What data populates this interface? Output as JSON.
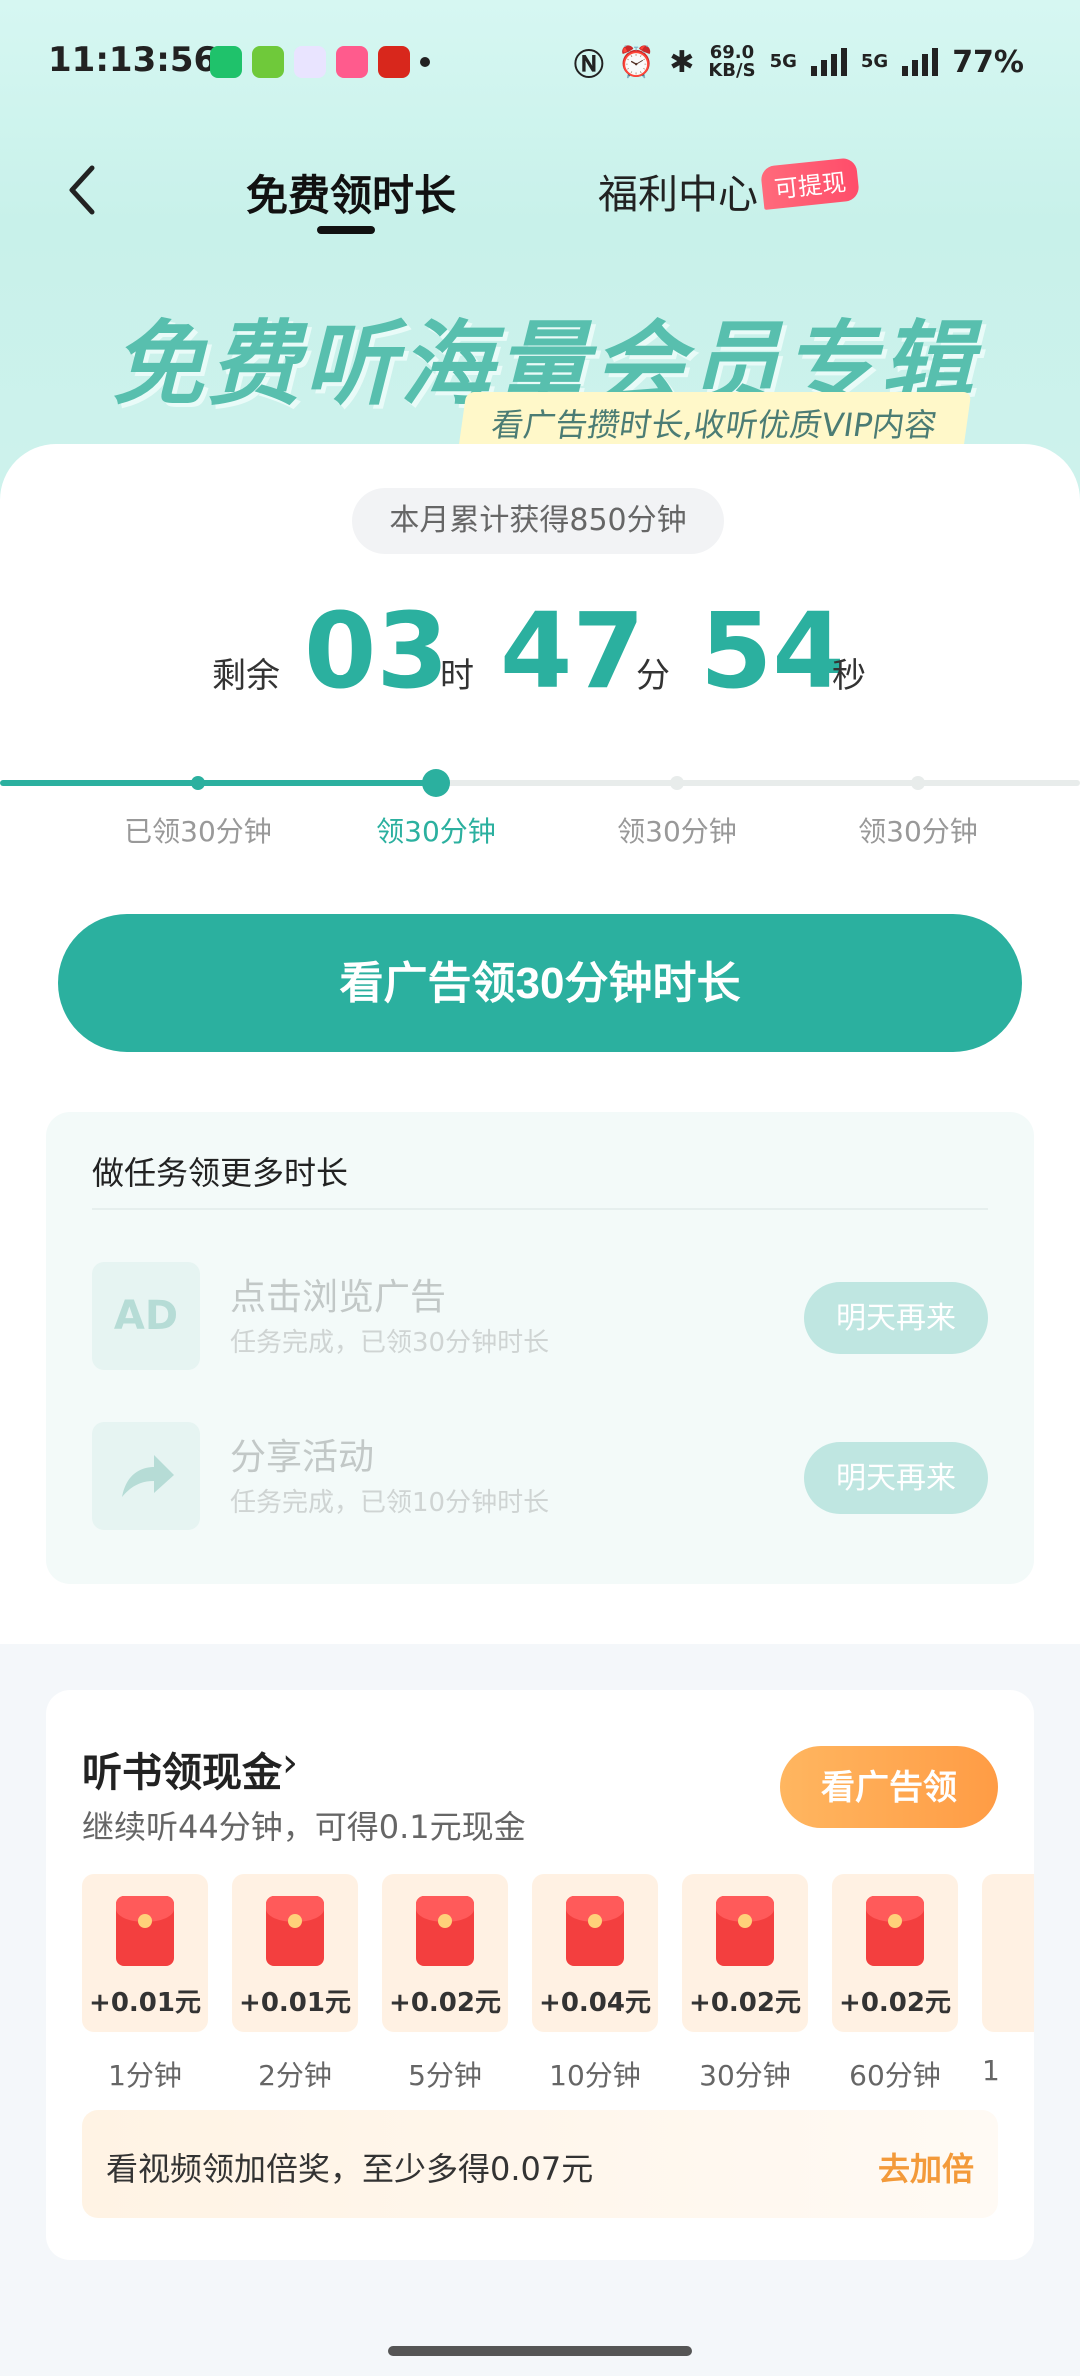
{
  "status_bar": {
    "time": "11:13:56",
    "net_speed": "69.0",
    "net_unit": "KB/S",
    "signal_1": "5G",
    "signal_2": "5G",
    "battery": "77%"
  },
  "nav": {
    "tab_free": "免费领时长",
    "tab_welfare": "福利中心",
    "welfare_badge": "可提现"
  },
  "banner": {
    "title": "免费听海量会员专辑",
    "subtitle": "看广告攒时长,收听优质VIP内容"
  },
  "summary": {
    "monthly_total": "本月累计获得850分钟",
    "remain_label": "剩余",
    "hours": "03",
    "hours_unit": "时",
    "minutes": "47",
    "minutes_unit": "分",
    "seconds": "54",
    "seconds_unit": "秒"
  },
  "progress": {
    "edge_label": "钟",
    "steps": [
      "已领30分钟",
      "领30分钟",
      "领30分钟",
      "领30分钟"
    ],
    "current_index": 1
  },
  "cta": {
    "label": "看广告领30分钟时长"
  },
  "tasks": {
    "title": "做任务领更多时长",
    "items": [
      {
        "icon": "ad-icon",
        "icon_text": "AD",
        "name": "点击浏览广告",
        "desc": "任务完成，已领30分钟时长",
        "button": "明天再来"
      },
      {
        "icon": "share-icon",
        "name": "分享活动",
        "desc": "任务完成，已领10分钟时长",
        "button": "明天再来"
      }
    ]
  },
  "cash": {
    "title": "听书领现金",
    "subtitle": "继续听44分钟，可得0.1元现金",
    "button": "看广告领",
    "rewards": [
      {
        "amount": "+0.01元",
        "minutes": "1分钟"
      },
      {
        "amount": "+0.01元",
        "minutes": "2分钟"
      },
      {
        "amount": "+0.02元",
        "minutes": "5分钟"
      },
      {
        "amount": "+0.04元",
        "minutes": "10分钟"
      },
      {
        "amount": "+0.02元",
        "minutes": "30分钟"
      },
      {
        "amount": "+0.02元",
        "minutes": "60分钟"
      }
    ],
    "reward_cut_label": "1",
    "double_text": "看视频领加倍奖，至少多得0.07元",
    "double_link": "去加倍"
  },
  "colors": {
    "accent": "#2bb09f",
    "orange": "#ff9c45",
    "red_envelope": "#f33f3f"
  }
}
